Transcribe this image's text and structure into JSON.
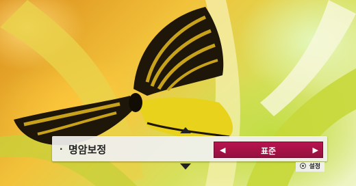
{
  "osd": {
    "item_bullet": "·",
    "item_label": "명암보정",
    "selector": {
      "value": "표준",
      "left_arrow": "◀",
      "right_arrow": "▶"
    },
    "hint": {
      "icon": "ok-button-icon",
      "label": "설정"
    },
    "up_arrow_icon": "up-arrow-icon",
    "down_arrow_icon": "down-arrow-icon"
  },
  "colors": {
    "selector_bg": "#b7144f",
    "panel_bg": "#f0f0f0"
  }
}
